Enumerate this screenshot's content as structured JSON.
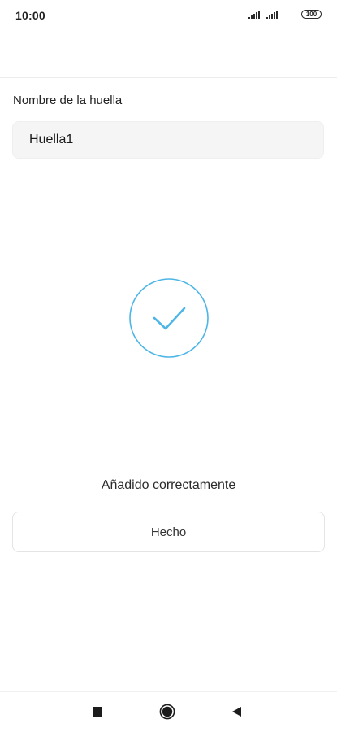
{
  "status_bar": {
    "time": "10:00",
    "battery": "100",
    "icons": [
      "signal-icon",
      "signal-icon",
      "battery-icon"
    ]
  },
  "form": {
    "label": "Nombre de la huella",
    "input_value": "Huella1"
  },
  "result": {
    "icon": "checkmark-circle-icon",
    "message": "Añadido correctamente"
  },
  "actions": {
    "done_label": "Hecho"
  },
  "nav_bar": {
    "icons": [
      "recent-apps-icon",
      "home-icon",
      "back-icon"
    ]
  },
  "colors": {
    "accent": "#4db6e6",
    "input_background": "#f5f5f5"
  }
}
